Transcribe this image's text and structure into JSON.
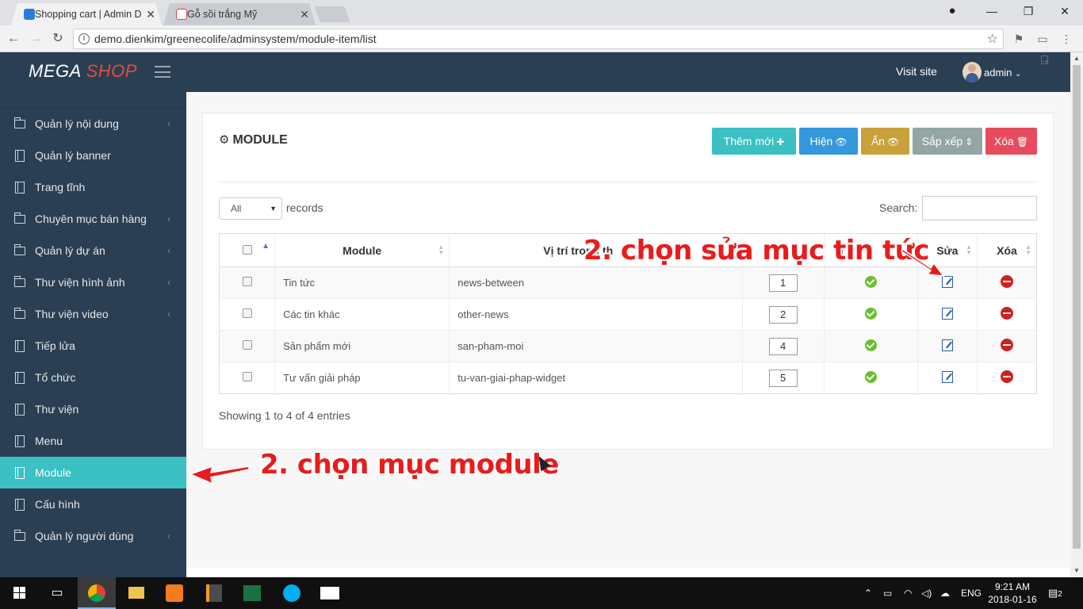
{
  "browser": {
    "tabs": [
      {
        "title": "Shopping cart | Admin D",
        "active": true
      },
      {
        "title": "Gỗ sồi trắng Mỹ",
        "active": false
      }
    ],
    "url": "demo.dienkim/greenecolife/adminsystem/module-item/list",
    "window_controls": {
      "minimize": "—",
      "maximize": "❐",
      "close": "✕"
    }
  },
  "header": {
    "brand_mega": "MEGA",
    "brand_shop": "SHOP",
    "visit_site": "Visit site",
    "user": "admin"
  },
  "sidebar": {
    "items": [
      {
        "label": "Quản lý nội dung",
        "icon": "folder-icon",
        "has_children": true
      },
      {
        "label": "Quản lý banner",
        "icon": "book-icon",
        "has_children": false
      },
      {
        "label": "Trang tĩnh",
        "icon": "book-icon",
        "has_children": false
      },
      {
        "label": "Chuyên mục bán hàng",
        "icon": "folder-icon",
        "has_children": true
      },
      {
        "label": "Quản lý dự án",
        "icon": "folder-icon",
        "has_children": true
      },
      {
        "label": "Thư viện hình ảnh",
        "icon": "folder-icon",
        "has_children": true
      },
      {
        "label": "Thư viện video",
        "icon": "folder-icon",
        "has_children": true
      },
      {
        "label": "Tiếp lửa",
        "icon": "book-icon",
        "has_children": false
      },
      {
        "label": "Tổ chức",
        "icon": "book-icon",
        "has_children": false
      },
      {
        "label": "Thư viện",
        "icon": "book-icon",
        "has_children": false
      },
      {
        "label": "Menu",
        "icon": "book-icon",
        "has_children": false
      },
      {
        "label": "Module",
        "icon": "book-icon",
        "has_children": false,
        "active": true
      },
      {
        "label": "Cấu hình",
        "icon": "book-icon",
        "has_children": false
      },
      {
        "label": "Quản lý người dùng",
        "icon": "folder-icon",
        "has_children": true
      }
    ]
  },
  "panel": {
    "title": "MODULE",
    "buttons": [
      {
        "label": "Thêm mới",
        "color": "#3bc0c3",
        "icon": "plus-icon",
        "glyph": "✚"
      },
      {
        "label": "Hiện",
        "color": "#3498db",
        "icon": "eye-icon",
        "glyph": "👁"
      },
      {
        "label": "Ẩn",
        "color": "#c9a13b",
        "icon": "eye-slash-icon",
        "glyph": "👁"
      },
      {
        "label": "Sắp xếp",
        "color": "#95a5a6",
        "icon": "sort-icon",
        "glyph": "⇕"
      },
      {
        "label": "Xóa",
        "color": "#e74c5e",
        "icon": "trash-icon",
        "glyph": "🗑"
      }
    ],
    "length_select": "All",
    "length_label": "records",
    "search_label": "Search:",
    "search_value": "",
    "columns": [
      "",
      "Module",
      "Vị trí trong th",
      "",
      "T",
      "Sửa",
      "Xóa"
    ],
    "rows": [
      {
        "module": "Tin tức",
        "position": "news-between",
        "order": "1"
      },
      {
        "module": "Các tin khác",
        "position": "other-news",
        "order": "2"
      },
      {
        "module": "Sản phẩm mới",
        "position": "san-pham-moi",
        "order": "4"
      },
      {
        "module": "Tư vấn giải pháp",
        "position": "tu-van-giai-phap-widget",
        "order": "5"
      }
    ],
    "showing": "Showing 1 to 4 of 4 entries"
  },
  "annotations": {
    "edit": "2. chọn sửa mục tin tức",
    "module": "2. chọn mục module",
    "color": "#e81c1c"
  },
  "taskbar": {
    "language": "ENG",
    "time": "9:21 AM",
    "date": "2018-01-16",
    "notifications": "2"
  }
}
